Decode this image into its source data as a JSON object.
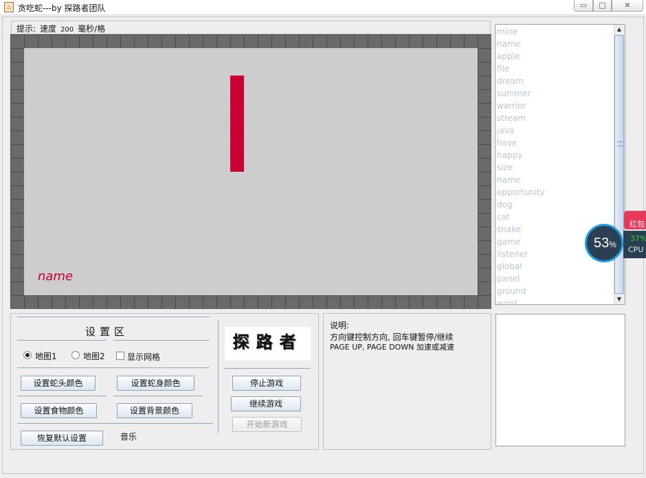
{
  "window": {
    "title": "贪吃蛇---by 探路者团队",
    "app_icon_glyph": "♨",
    "minimize_glyph": "▭",
    "maximize_glyph": "□",
    "close_glyph": "✕"
  },
  "tip_bar": {
    "label": "提示:",
    "speed_label": "速度",
    "speed_value": "200",
    "unit": "毫秒/格"
  },
  "game": {
    "food_word": "name",
    "snake_color": "#cc0033",
    "background_color": "#cdcdcd",
    "wall_color": "#6a6a6a"
  },
  "word_list": {
    "items": [
      "mine",
      "name",
      "apple",
      "file",
      "dream",
      "summer",
      "warrior",
      "stream",
      "java",
      "have",
      "happy",
      "size",
      "name",
      "opportunity",
      "dog",
      "cat",
      "snake",
      "game",
      "listener",
      "global",
      "panel",
      "ground",
      "word"
    ],
    "scroll_up": "▲",
    "scroll_down": "▼"
  },
  "settings": {
    "title": "设置区",
    "map1": "地图1",
    "map2": "地图2",
    "map1_selected": true,
    "show_grid": "显示网格",
    "show_grid_checked": false,
    "head_color_btn": "设置蛇头颜色",
    "body_color_btn": "设置蛇身颜色",
    "food_color_btn": "设置食物颜色",
    "bg_color_btn": "设置背景颜色",
    "reset_btn": "恢复默认设置",
    "music_label": "音乐"
  },
  "controls": {
    "logo_text": "探路者",
    "stop_btn": "停止游戏",
    "resume_btn": "继续游戏",
    "new_game_btn": "开始新游戏"
  },
  "instructions": {
    "title": "说明:",
    "line1": "方向键控制方向, 回车键暂停/继续",
    "line2": "PAGE UP, PAGE DOWN 加速或减速"
  },
  "overlay": {
    "cpu_ring_value": "53",
    "cpu_ring_unit": "%",
    "cpu_percent": "37%",
    "cpu_label": "CPU",
    "app_badge": "红包"
  }
}
